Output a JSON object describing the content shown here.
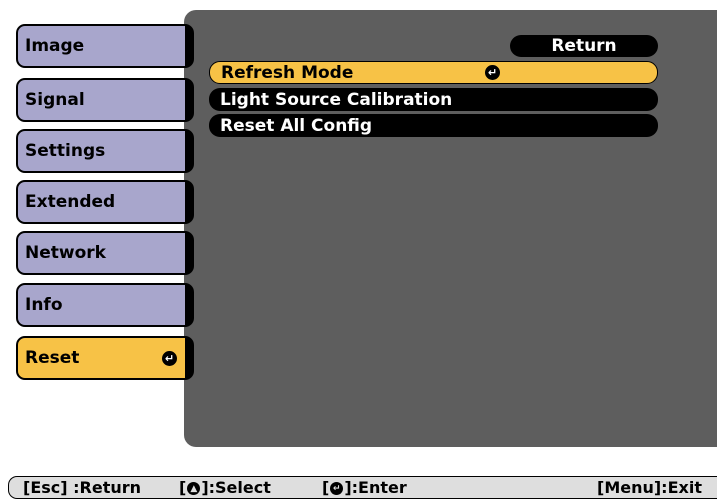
{
  "sidebar": {
    "items": [
      {
        "label": "Image"
      },
      {
        "label": "Signal"
      },
      {
        "label": "Settings"
      },
      {
        "label": "Extended"
      },
      {
        "label": "Network"
      },
      {
        "label": "Info"
      },
      {
        "label": "Reset",
        "active": true
      }
    ]
  },
  "main": {
    "return_label": "Return",
    "items": [
      {
        "label": "Refresh Mode",
        "selected": true
      },
      {
        "label": "Light Source Calibration"
      },
      {
        "label": "Reset All Config"
      }
    ]
  },
  "footer": {
    "esc_hint": "[Esc] :Return",
    "select_hint_pre": "[",
    "select_hint_post": "]:Select",
    "enter_hint_pre": "[",
    "enter_hint_post": "]:Enter",
    "menu_hint": "[Menu]:Exit"
  },
  "colors": {
    "highlight": "#f7c246",
    "sidebar": "#a8a6cc",
    "panel": "#5e5e5e"
  },
  "icons": {
    "enter": "enter-icon",
    "updown": "updown-arrows-icon"
  }
}
